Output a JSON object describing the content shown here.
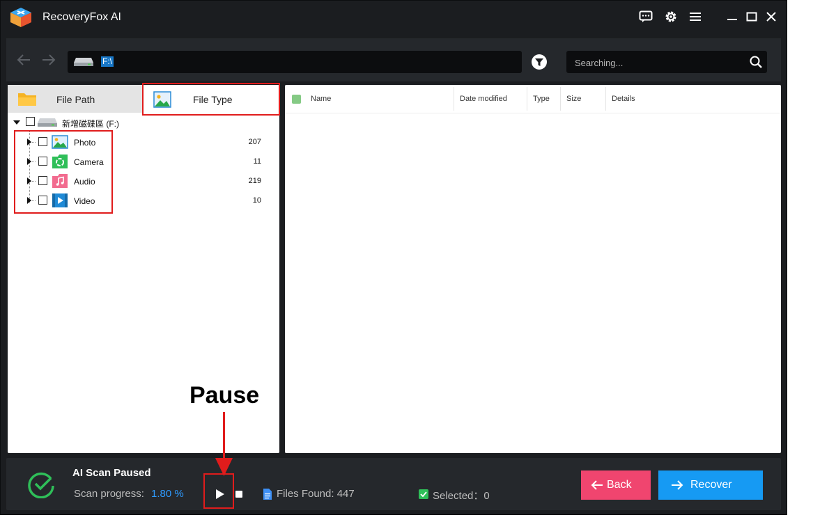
{
  "app": {
    "title": "RecoveryFox AI"
  },
  "toolbar": {
    "path": "F:\\",
    "search_placeholder": "Searching..."
  },
  "tabs": [
    {
      "label": "File Path"
    },
    {
      "label": "File Type"
    }
  ],
  "tree": {
    "root_label": "新增磁碟區 (F:)",
    "items": [
      {
        "label": "Photo",
        "count": "207"
      },
      {
        "label": "Camera",
        "count": "11"
      },
      {
        "label": "Audio",
        "count": "219"
      },
      {
        "label": "Video",
        "count": "10"
      }
    ]
  },
  "columns": [
    "Name",
    "Date modified",
    "Type",
    "Size",
    "Details"
  ],
  "status": {
    "title": "AI Scan Paused",
    "progress_label": "Scan progress:",
    "progress_value": "1.80 %",
    "files_found": "Files Found: 447",
    "selected": "Selected：0"
  },
  "buttons": {
    "back": "Back",
    "recover": "Recover"
  },
  "annotation": {
    "pause_label": "Pause"
  },
  "colors": {
    "accent_blue": "#169af3",
    "back_pink": "#f0456f",
    "highlight_red": "#e01c1c",
    "progress_blue": "#2e9bff"
  }
}
